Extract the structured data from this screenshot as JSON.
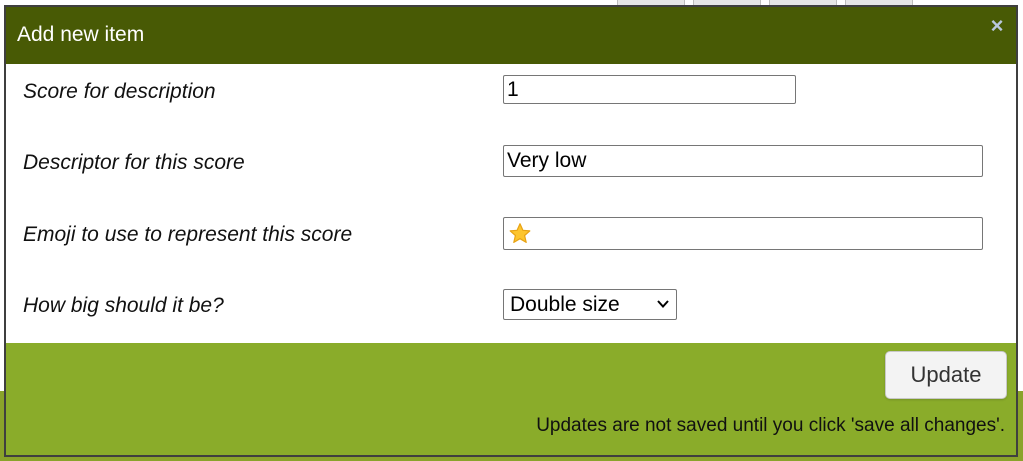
{
  "dialog": {
    "title": "Add new item",
    "close_symbol": "×"
  },
  "fields": {
    "score": {
      "label": "Score for description",
      "value": "1"
    },
    "descriptor": {
      "label": "Descriptor for this score",
      "value": "Very low"
    },
    "emoji": {
      "label": "Emoji to use to represent this score",
      "value_icon": "star-emoji"
    },
    "size": {
      "label": "How big should it be?",
      "selected": "Double size"
    }
  },
  "footer": {
    "update_label": "Update",
    "note": "Updates are not saved until you click 'save all changes'."
  },
  "colors": {
    "header_bg": "#485a05",
    "footer_bg": "#8aac2a",
    "close_icon": "#b9c7dd"
  }
}
